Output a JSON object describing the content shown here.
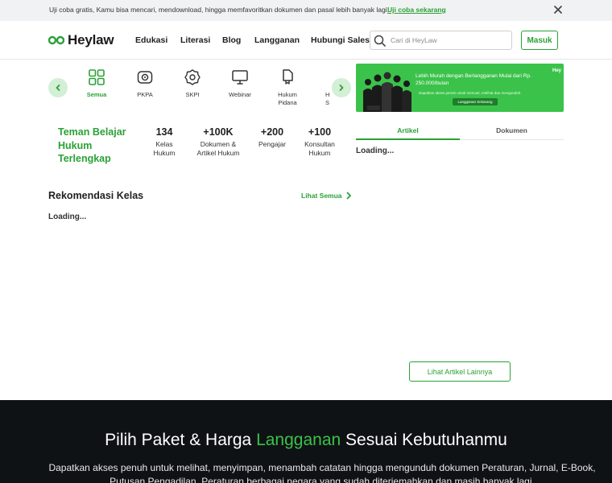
{
  "banner": {
    "text": "Uji coba gratis, Kamu bisa mencari, mendownload, hingga memfavoritkan dokumen dan pasal lebih banyak lagi!",
    "link": "Uji coba sekarang"
  },
  "header": {
    "logo": "Heylaw",
    "nav": [
      "Edukasi",
      "Literasi",
      "Blog",
      "Langganan",
      "Hubungi Sales"
    ],
    "search_placeholder": "Cari di HeyLaw",
    "login": "Masuk"
  },
  "categories": [
    {
      "label": "Semua",
      "icon": "grid-icon",
      "active": true
    },
    {
      "label": "PKPA",
      "icon": "badge-icon",
      "active": false
    },
    {
      "label": "SKPI",
      "icon": "award-icon",
      "active": false
    },
    {
      "label": "Webinar",
      "icon": "monitor-icon",
      "active": false
    },
    {
      "label": "Hukum Pidana",
      "icon": "document-icon",
      "active": false
    },
    {
      "label": "H S",
      "icon": "book-icon",
      "active": false
    }
  ],
  "promo": {
    "title": "Lebih Murah dengan Berlangganan Mulai dari Rp. 250.000/bulan",
    "subtitle": "Dapatkan akses penuh untuk mencari, melihat dan mengunduh",
    "cta": "Langganan Sekarang",
    "brand": "Hey"
  },
  "stats": {
    "tagline": "Teman Belajar Hukum Terlengkap",
    "items": [
      {
        "value": "134",
        "label": "Kelas Hukum"
      },
      {
        "value": "+100K",
        "label": "Dokumen & Artikel Hukum"
      },
      {
        "value": "+200",
        "label": "Pengajar"
      },
      {
        "value": "+100",
        "label": "Konsultan Hukum"
      }
    ]
  },
  "tabs": [
    "Artikel",
    "Dokumen"
  ],
  "loading": "Loading...",
  "recommend": {
    "title": "Rekomendasi Kelas",
    "see_all": "Lihat Semua"
  },
  "more_articles": "Lihat Artikel Lainnya",
  "pricing": {
    "title_pre": "Pilih Paket & Harga ",
    "title_accent": "Langganan",
    "title_post": " Sesuai Kebutuhanmu",
    "description": "Dapatkan akses penuh untuk melihat, menyimpan, menambah catatan hingga mengunduh dokumen Peraturan, Jurnal, E-Book, Putusan Pengadilan, Peraturan berbagai negara yang sudah diterjemahkan dan masih banyak lagi."
  },
  "colors": {
    "brand_green": "#2aa136",
    "light_green": "#d3efd5",
    "promo_green": "#3bc24a",
    "dark_bg": "#0f1214"
  }
}
